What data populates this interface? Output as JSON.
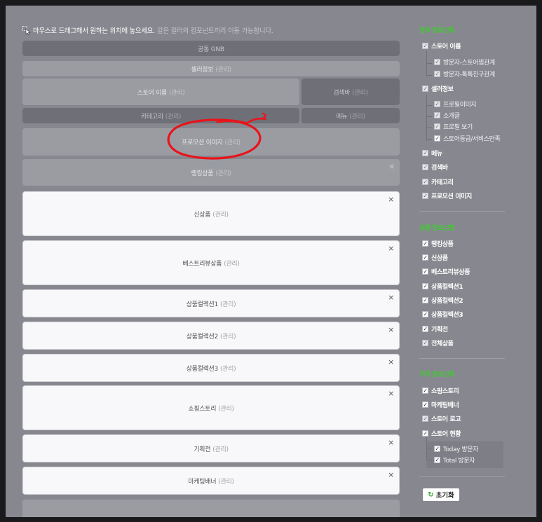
{
  "notice": {
    "bold": "마우스로 드래그해서 원하는 위치에 놓으세요.",
    "light": "같은 컬러의 컴포넌트끼리 이동 가능합니다."
  },
  "manage_label": "(관리)",
  "layout": {
    "gnb": "공통 GNB",
    "seller_info": "셀러정보",
    "store_name": "스토어 이름",
    "search_bar": "검색바",
    "category": "카테고리",
    "menu": "메뉴",
    "promotion_image": "프로모션 이미지",
    "ranking_products": "랭킹상품",
    "new_products": "신상품",
    "best_review": "베스트리뷰상품",
    "collection1": "상품컬렉션1",
    "collection2": "상품컬렉션2",
    "collection3": "상품컬렉션3",
    "shopping_story": "쇼핑스토리",
    "special": "기획전",
    "marketing_banner": "마케팅배너",
    "close_symbol": "×"
  },
  "panel": {
    "info_title": "정보 컴포넌트",
    "info": {
      "store_name": "스토어 이름",
      "visitor_store_relation": "방문자-스토어찜관계",
      "visitor_talk_friend": "방문자-톡톡친구관계",
      "seller_info": "셀러정보",
      "profile_image": "프로필이미지",
      "intro": "소개글",
      "profile_view": "프로필 보기",
      "store_grade": "스토어등급/서비스만족",
      "menu": "메뉴",
      "search_bar": "검색바",
      "category": "카테고리",
      "promotion_image": "프로모션 이미지"
    },
    "product_title": "상품 컴포넌트",
    "product": {
      "ranking": "랭킹상품",
      "new": "신상품",
      "best_review": "베스트리뷰상품",
      "collection1": "상품컬렉션1",
      "collection2": "상품컬렉션2",
      "collection3": "상품컬렉션3",
      "special": "기획전",
      "all_products": "전체상품"
    },
    "etc_title": "기타 컴포넌트",
    "etc": {
      "shopping_story": "쇼핑스토리",
      "marketing_banner": "마케팅배너",
      "store_logo": "스토어 로고",
      "store_status": "스토어 현황",
      "today_visitors": "Today 방문자",
      "total_visitors": "Total 방문자"
    },
    "reset_label": "초기화"
  },
  "colors": {
    "accent_green": "#3ecb2f",
    "annotation_red": "#e8141c"
  }
}
